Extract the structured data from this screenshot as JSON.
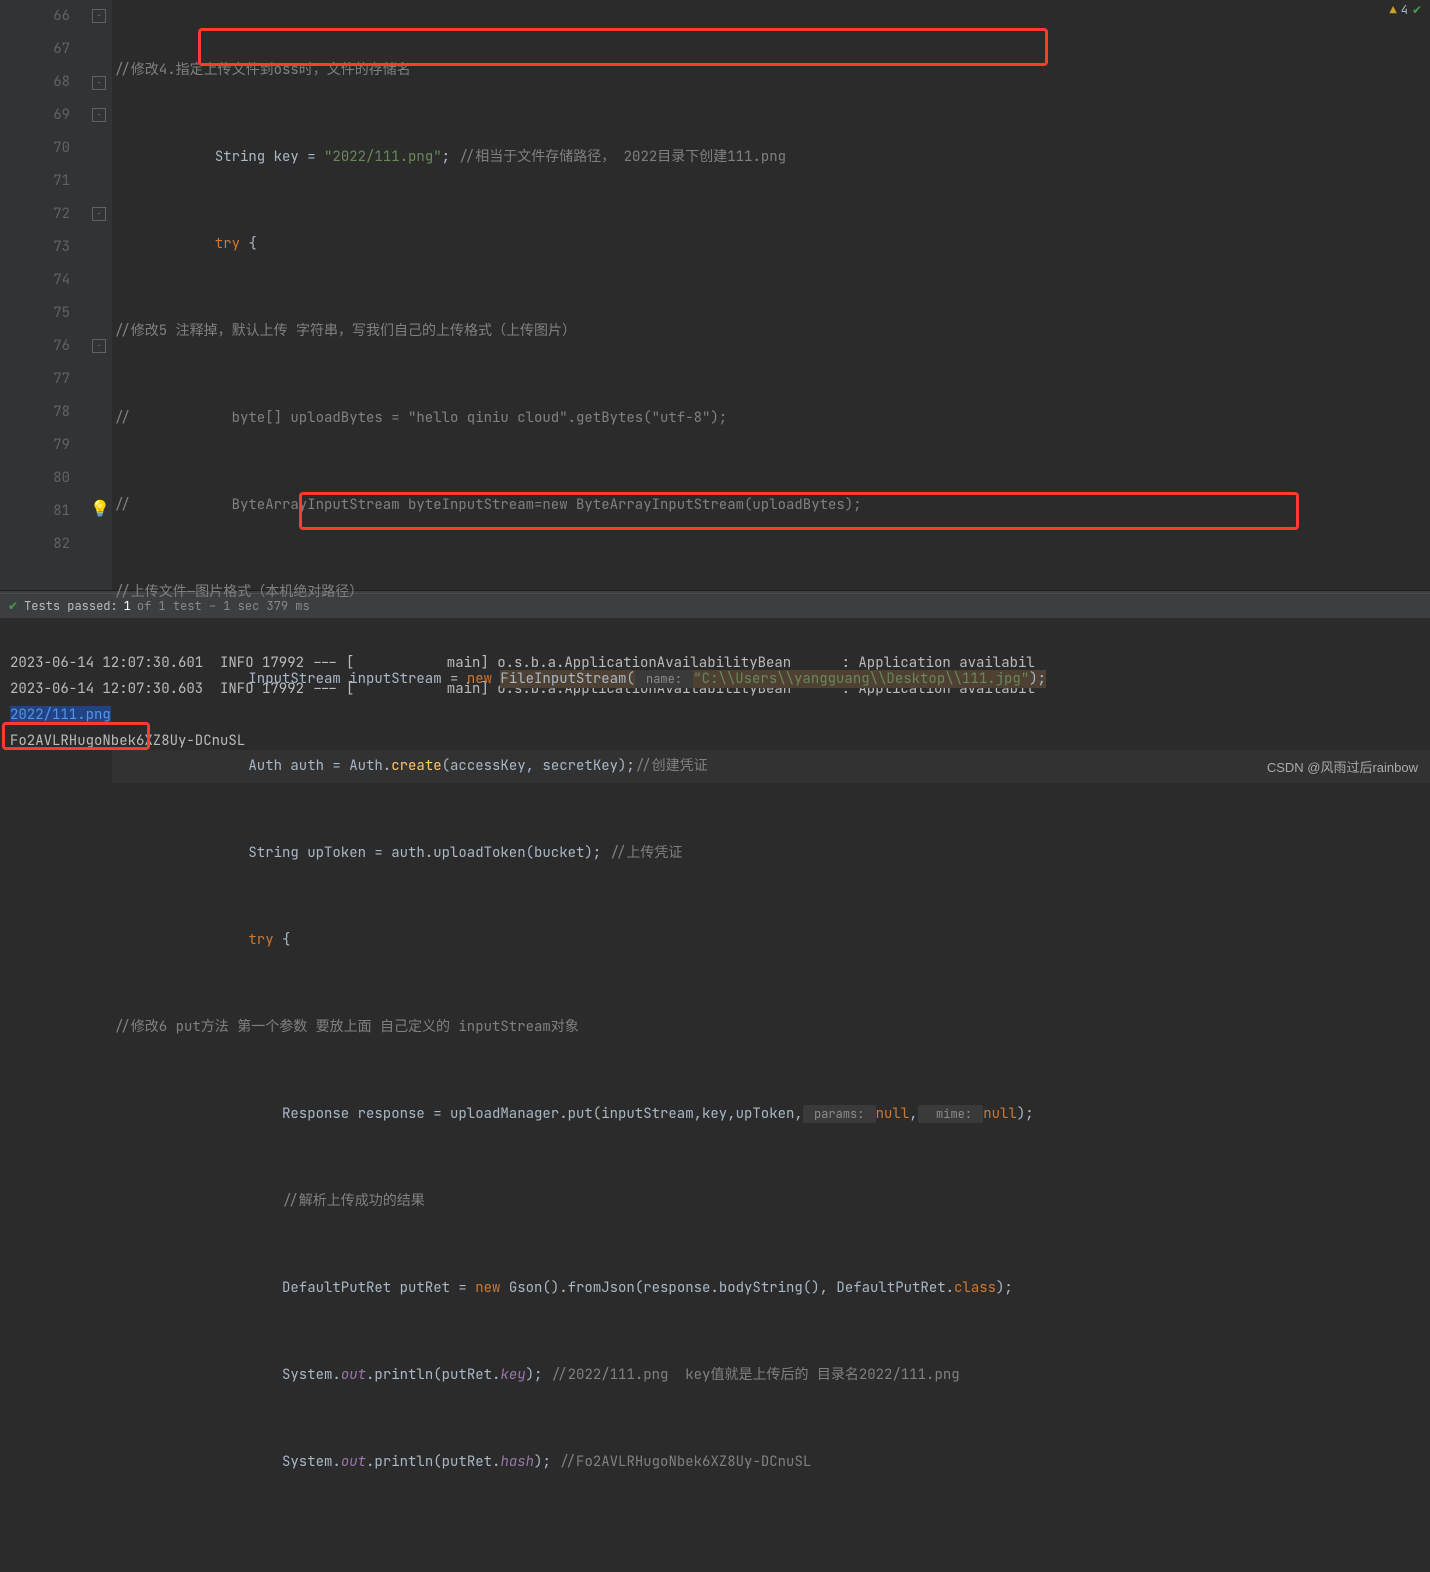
{
  "problems": {
    "warnings": 4
  },
  "gutter": {
    "start": 66,
    "end": 82,
    "bulb_line": 81
  },
  "code": {
    "l66": {
      "comment": "//修改4.指定上传文件到oss时，文件的存储名"
    },
    "l67": {
      "kw1": "String ",
      "ident": "key",
      "eq": " = ",
      "str": "\"2022/111.png\"",
      "semi": ";",
      "com": " //相当于文件存储路径， 2022目录下创建111.png"
    },
    "l68": {
      "kw": "try",
      "brace": " {"
    },
    "l69": {
      "com": "//修改5 注释掉，默认上传 字符串，写我们自己的上传格式（上传图片）"
    },
    "l70": {
      "com": "//            byte[] uploadBytes = \"hello qiniu cloud\".getBytes(\"utf-8\");"
    },
    "l71": {
      "com": "//            ByteArrayInputStream byteInputStream=new ByteArrayInputStream(uploadBytes);"
    },
    "l72": {
      "com": "//上传文件—图片格式（本机绝对路径）"
    },
    "l73": {
      "t1": "InputStream inputStream = ",
      "kw_new": "new",
      "sp1": " ",
      "cls": "FileInputStream",
      "p1": "(",
      "param_hint": " name: ",
      "str": "\"C:\\\\Users\\\\yangguang\\\\Desktop\\\\111.jpg\"",
      "p2": ");"
    },
    "l74": {
      "t1": "Auth auth = Auth.",
      "m": "create",
      "p1": "(accessKey, secretKey);",
      "com": "//创建凭证"
    },
    "l75": {
      "t1": "String upToken = auth.uploadToken(bucket); ",
      "com": "//上传凭证"
    },
    "l76": {
      "kw": "try",
      "brace": " {"
    },
    "l77": {
      "com": "//修改6 put方法 第一个参数 要放上面 自己定义的 inputStream对象"
    },
    "l78": {
      "t1": "Response response = uploadManager.put(inputStream,key,upToken,",
      "hint1": " params: ",
      "kw_null1": "null",
      "comma1": ",",
      "hint2": "  mime: ",
      "kw_null2": "null",
      "p2": ");"
    },
    "l79": {
      "com": "//解析上传成功的结果"
    },
    "l80": {
      "t1": "DefaultPutRet putRet = ",
      "kw_new": "new",
      "sp1": " ",
      "cls": "Gson",
      "p1": "().fromJson(response.bodyString(), DefaultPutRet.",
      "kw_class": "class",
      "p2": ");"
    },
    "l81": {
      "t1": "System.",
      "out": "out",
      "dot": ".",
      "m": "println",
      "p1": "(putRet.",
      "field": "key",
      "p2": ");",
      "com": " //2022/111.png  key值就是上传后的 目录名2022/111.png"
    },
    "l82": {
      "t1": "System.",
      "out": "out",
      "dot": ".",
      "m": "println",
      "p1": "(putRet.",
      "field": "hash",
      "p2": ");",
      "com": " //Fo2AVLRHugoNbek6XZ8Uy-DCnuSL"
    }
  },
  "test_bar": {
    "passed_prefix": "Tests passed:",
    "passed_count": "1",
    "of_text": "of 1 test – 1 sec 379 ms"
  },
  "console": {
    "line1": "2023-06-14 12:07:30.601  INFO 17992 --- [           main] o.s.b.a.ApplicationAvailabilityBean      : Application availabil",
    "line2": "2023-06-14 12:07:30.603  INFO 17992 --- [           main] o.s.b.a.ApplicationAvailabilityBean      : Application availabil",
    "line3": "2022/111.png",
    "line4": "Fo2AVLRHugoNbek6XZ8Uy-DCnuSL"
  },
  "watermark": "CSDN @风雨过后rainbow"
}
